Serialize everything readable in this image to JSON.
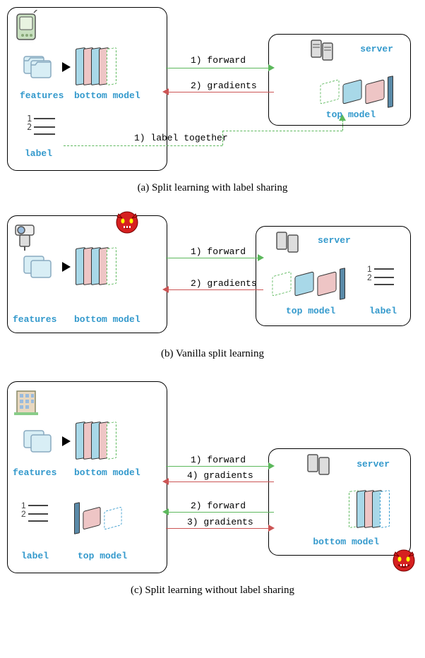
{
  "diagrams": [
    {
      "id": "a",
      "caption": "(a) Split learning with label sharing",
      "client": {
        "device_type": "pda",
        "features_label": "features",
        "bottom_model_label": "bottom model",
        "label_label": "label"
      },
      "server": {
        "server_label": "server",
        "top_model_label": "top model"
      },
      "arrows": {
        "forward": "1) forward",
        "gradients": "2) gradients",
        "label_together": "1) label together"
      }
    },
    {
      "id": "b",
      "caption": "(b) Vanilla split learning",
      "client": {
        "device_type": "camera",
        "features_label": "features",
        "bottom_model_label": "bottom model",
        "has_devil": true
      },
      "server": {
        "server_label": "server",
        "top_model_label": "top model",
        "label_label": "label"
      },
      "arrows": {
        "forward": "1) forward",
        "gradients": "2) gradients"
      }
    },
    {
      "id": "c",
      "caption": "(c) Split learning without label sharing",
      "client": {
        "device_type": "building",
        "features_label": "features",
        "bottom_model_label": "bottom model",
        "label_label": "label",
        "top_model_label": "top model"
      },
      "server": {
        "server_label": "server",
        "bottom_model_label": "bottom model",
        "has_devil": true
      },
      "arrows": {
        "forward1": "1) forward",
        "gradients4": "4) gradients",
        "forward2": "2) forward",
        "gradients3": "3) gradients"
      }
    }
  ]
}
